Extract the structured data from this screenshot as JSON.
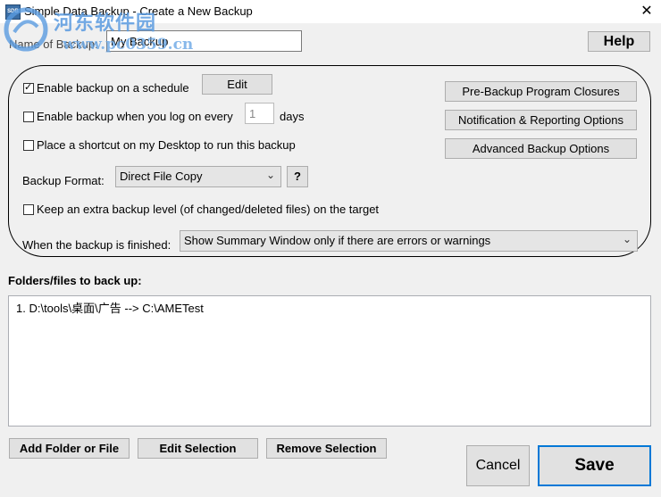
{
  "window": {
    "title": "Simple Data Backup - Create a New Backup",
    "close_glyph": "✕"
  },
  "watermark": {
    "line1": "河东软件园",
    "line2": "www.pc0359.cn"
  },
  "name_field": {
    "label": "Name of Backup:",
    "value": "My Backup"
  },
  "help_label": "Help",
  "options": {
    "schedule": {
      "label": "Enable backup on a schedule",
      "checked": true,
      "edit_label": "Edit"
    },
    "logon": {
      "label": "Enable backup when you log on every",
      "checked": false,
      "days_value": "1",
      "days_label": "days"
    },
    "shortcut": {
      "label": "Place a shortcut on my Desktop to run this backup",
      "checked": false
    },
    "format": {
      "label": "Backup Format:",
      "value": "Direct File Copy",
      "help": "?"
    },
    "extra_level": {
      "label": "Keep an extra backup level (of changed/deleted files) on the target",
      "checked": false
    },
    "finished": {
      "label": "When the backup is finished:",
      "value": "Show Summary Window only if there are errors or warnings"
    },
    "right_buttons": [
      "Pre-Backup Program Closures",
      "Notification & Reporting Options",
      "Advanced Backup Options"
    ]
  },
  "files": {
    "heading": "Folders/files to back up:",
    "items": [
      "1. D:\\tools\\桌面\\广告 --> C:\\AMETest"
    ]
  },
  "bottom": {
    "add": "Add Folder or File",
    "edit": "Edit Selection",
    "remove": "Remove Selection",
    "cancel": "Cancel",
    "save": "Save"
  },
  "colors": {
    "accent_border": "#0078d7",
    "watermark": "#5a9be0"
  }
}
